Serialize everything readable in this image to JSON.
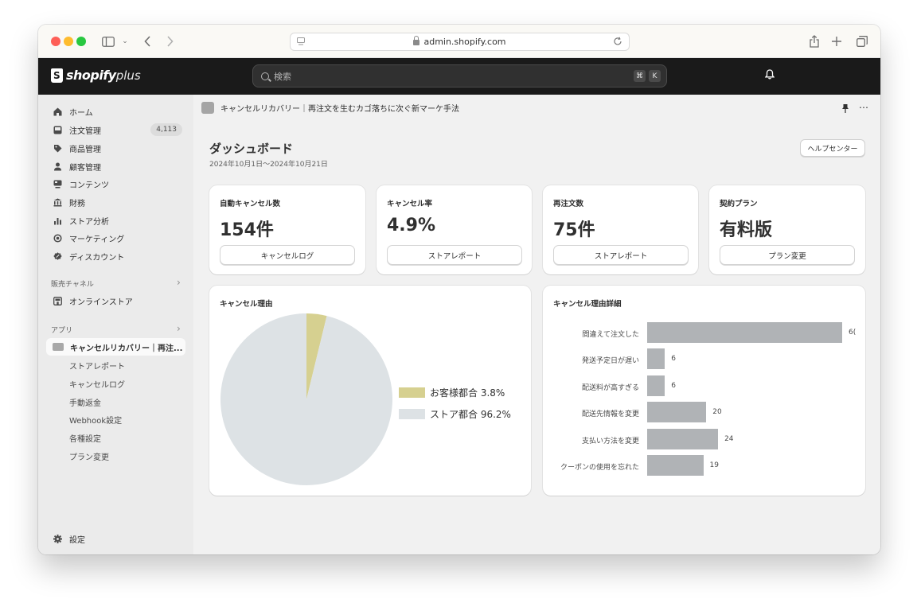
{
  "browser": {
    "url": "admin.shopify.com"
  },
  "topbar": {
    "logo_text": "shopify",
    "logo_plus": "plus",
    "search_placeholder": "検索",
    "shortcut_cmd": "⌘",
    "shortcut_key": "K"
  },
  "sidebar": {
    "items": [
      {
        "label": "ホーム",
        "icon": "home-icon"
      },
      {
        "label": "注文管理",
        "icon": "inbox-icon",
        "badge": "4,113"
      },
      {
        "label": "商品管理",
        "icon": "tag-icon"
      },
      {
        "label": "顧客管理",
        "icon": "person-icon"
      },
      {
        "label": "コンテンツ",
        "icon": "content-icon"
      },
      {
        "label": "財務",
        "icon": "bank-icon"
      },
      {
        "label": "ストア分析",
        "icon": "bar-chart-icon"
      },
      {
        "label": "マーケティング",
        "icon": "target-icon"
      },
      {
        "label": "ディスカウント",
        "icon": "discount-icon"
      }
    ],
    "sales_channels_label": "販売チャネル",
    "online_store_label": "オンラインストア",
    "apps_label": "アプリ",
    "app_active_label": "キャンセルリカバリー｜再注...",
    "app_sub_items": [
      "ストアレポート",
      "キャンセルログ",
      "手動返金",
      "Webhook設定",
      "各種設定",
      "プラン変更"
    ],
    "settings_label": "設定"
  },
  "main": {
    "breadcrumb": "キャンセルリカバリー｜再注文を生むカゴ落ちに次ぐ新マーケ手法",
    "title": "ダッシュボード",
    "date_range": "2024年10月1日〜2024年10月21日",
    "help_button": "ヘルプセンター",
    "stat_cards": [
      {
        "label": "自動キャンセル数",
        "value": "154件",
        "button": "キャンセルログ"
      },
      {
        "label": "キャンセル率",
        "value": "4.9%",
        "button": "ストアレポート"
      },
      {
        "label": "再注文数",
        "value": "75件",
        "button": "ストアレポート"
      },
      {
        "label": "契約プラン",
        "value": "有料版",
        "button": "プラン変更"
      }
    ]
  },
  "chart_data": [
    {
      "type": "pie",
      "title": "キャンセル理由",
      "categories": [
        "お客様都合",
        "ストア都合"
      ],
      "values": [
        3.8,
        96.2
      ],
      "legend_labels": [
        "お客様都合 3.8%",
        "ストア都合 96.2%"
      ],
      "colors": [
        "#d6d090",
        "#dde2e5"
      ],
      "legend": "right"
    },
    {
      "type": "bar",
      "orientation": "horizontal",
      "title": "キャンセル理由詳細",
      "categories": [
        "間違えて注文した",
        "発送予定日が遅い",
        "配送料が高すぎる",
        "配送先情報を変更",
        "支払い方法を変更",
        "クーポンの使用を忘れた"
      ],
      "values": [
        66,
        6,
        6,
        20,
        24,
        19
      ],
      "value_labels": [
        "6(",
        "6",
        "6",
        "20",
        "24",
        "19"
      ],
      "xlim": [
        0,
        66
      ],
      "color": "#b0b3b6"
    }
  ]
}
